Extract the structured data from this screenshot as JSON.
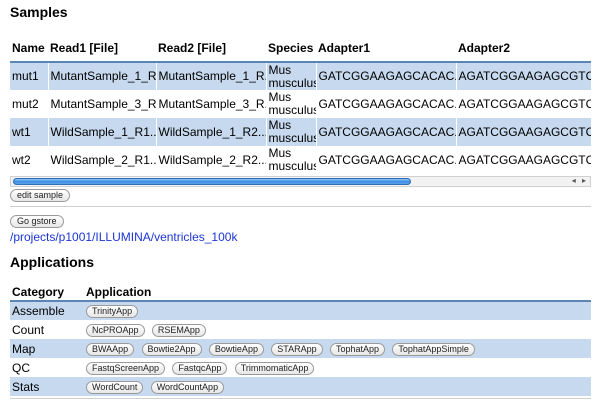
{
  "samples": {
    "title": "Samples",
    "columns": [
      "Name",
      "Read1 [File]",
      "Read2 [File]",
      "Species",
      "Adapter1",
      "Adapter2"
    ],
    "rows": [
      {
        "name": "mut1",
        "read1": "MutantSample_1_R...",
        "read2": "MutantSample_1_R...",
        "species": "Mus musculus",
        "adapter1": "GATCGGAAGAGCACAC...",
        "adapter2": "AGATCGGAAGAGCGTC..."
      },
      {
        "name": "mut2",
        "read1": "MutantSample_3_R...",
        "read2": "MutantSample_3_R...",
        "species": "Mus musculus",
        "adapter1": "GATCGGAAGAGCACAC...",
        "adapter2": "AGATCGGAAGAGCGTC..."
      },
      {
        "name": "wt1",
        "read1": "WildSample_1_R1...",
        "read2": "WildSample_1_R2...",
        "species": "Mus musculus",
        "adapter1": "GATCGGAAGAGCACAC...",
        "adapter2": "AGATCGGAAGAGCGTC..."
      },
      {
        "name": "wt2",
        "read1": "WildSample_2_R1...",
        "read2": "WildSample_2_R2...",
        "species": "Mus musculus",
        "adapter1": "GATCGGAAGAGCACAC...",
        "adapter2": "AGATCGGAAGAGCGTC..."
      }
    ],
    "scroll_arrows": "◂ ▸",
    "edit_button": "edit sample"
  },
  "gstore": {
    "button": "Go gstore",
    "path": "/projects/p1001/ILLUMINA/ventricles_100k"
  },
  "applications": {
    "title": "Applications",
    "columns": [
      "Category",
      "Application"
    ],
    "rows": [
      {
        "category": "Assemble",
        "apps": [
          "TrinityApp"
        ]
      },
      {
        "category": "Count",
        "apps": [
          "NcPROApp",
          "RSEMApp"
        ]
      },
      {
        "category": "Map",
        "apps": [
          "BWAApp",
          "Bowtie2App",
          "BowtieApp",
          "STARApp",
          "TophatApp",
          "TophatAppSimple"
        ]
      },
      {
        "category": "QC",
        "apps": [
          "FastqScreenApp",
          "FastqcApp",
          "TrimmomaticApp"
        ]
      },
      {
        "category": "Stats",
        "apps": [
          "WordCount",
          "WordCountApp"
        ]
      }
    ]
  },
  "colors": {
    "row_highlight": "#c6d9ee",
    "header_rule": "#5b85b2",
    "link": "#1b35d6",
    "scroll_thumb": "#3d8de0"
  }
}
